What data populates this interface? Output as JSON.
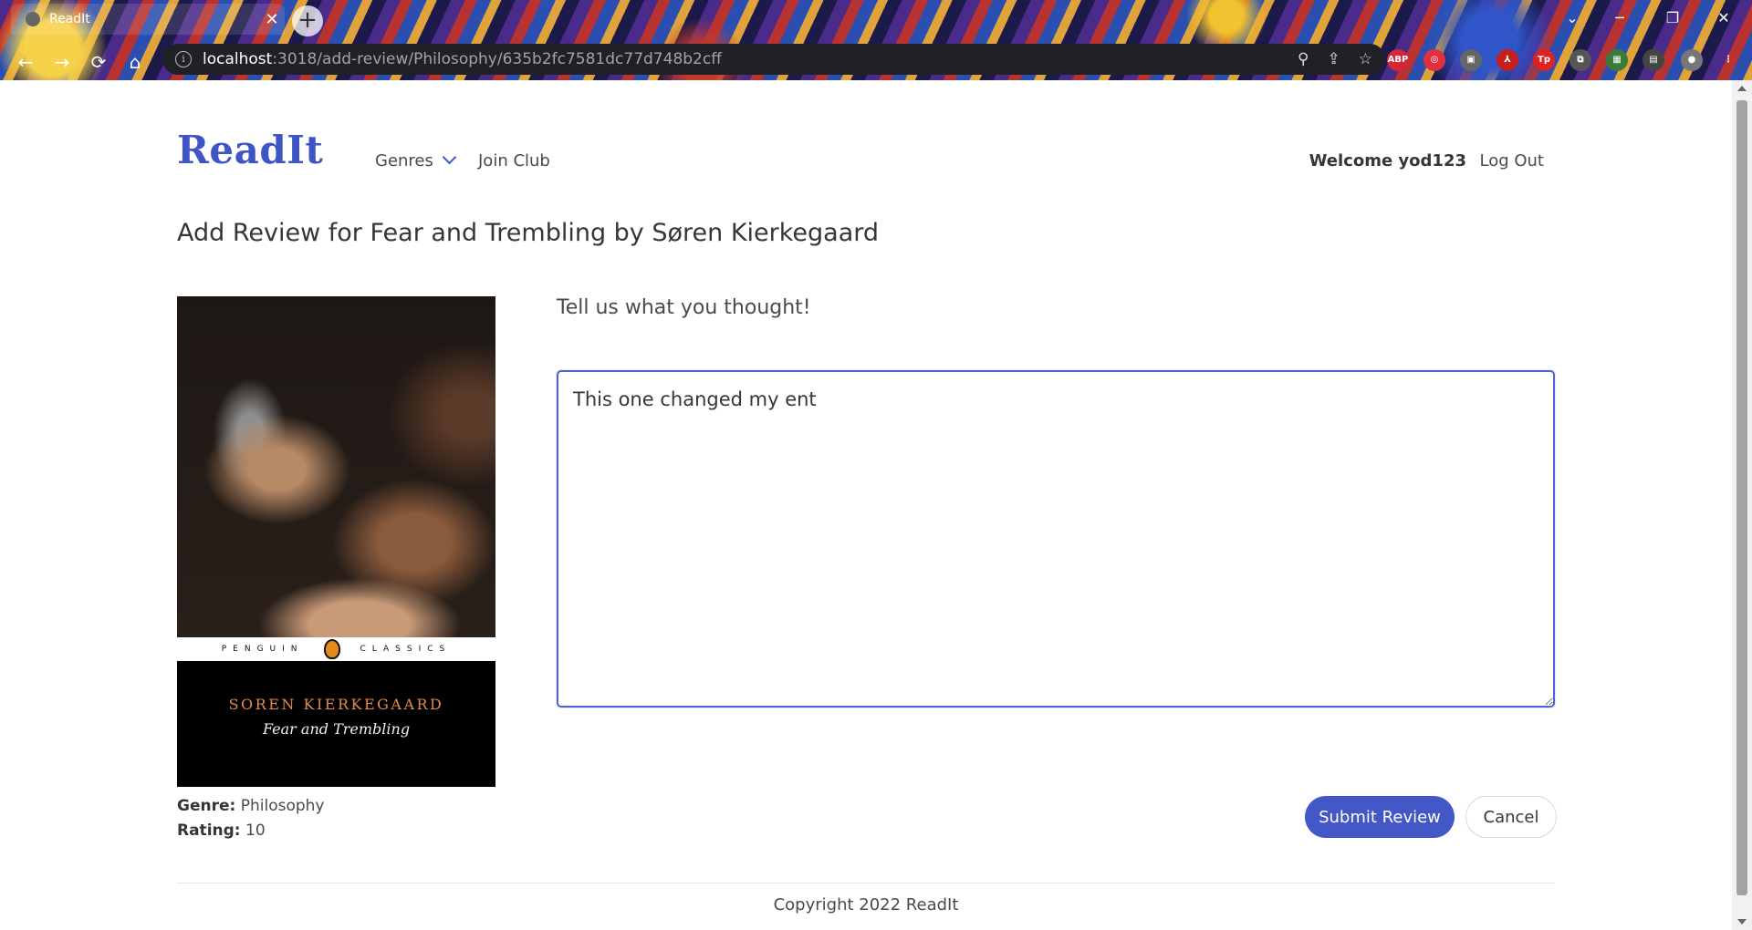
{
  "browser": {
    "tab_title": "ReadIt",
    "url_host": "localhost",
    "url_path": ":3018/add-review/Philosophy/635b2fc7581dc77d748b2cff"
  },
  "nav": {
    "brand": "ReadIt",
    "genres_label": "Genres",
    "join_club_label": "Join Club",
    "welcome_text": "Welcome yod123",
    "logout_label": "Log Out"
  },
  "page": {
    "title": "Add Review for Fear and Trembling by Søren Kierkegaard",
    "prompt": "Tell us what you thought!"
  },
  "book": {
    "cover_series": "PENGUIN CLASSICS",
    "cover_series_left": "PENGUIN",
    "cover_series_right": "CLASSICS",
    "cover_author": "SOREN KIERKEGAARD",
    "cover_title": "Fear and Trembling",
    "genre_label": "Genre:",
    "genre_value": "Philosophy",
    "rating_label": "Rating:",
    "rating_value": "10"
  },
  "review": {
    "text": "This one changed my ent"
  },
  "buttons": {
    "submit": "Submit Review",
    "cancel": "Cancel"
  },
  "footer": {
    "copyright": "Copyright 2022 ReadIt"
  },
  "colors": {
    "brand": "#3e56c4",
    "primary_button": "#4357c6",
    "focus_border": "#4f63cc"
  },
  "icons": {
    "genres_dropdown": "chevron-down-icon",
    "address_info": "info-icon"
  }
}
